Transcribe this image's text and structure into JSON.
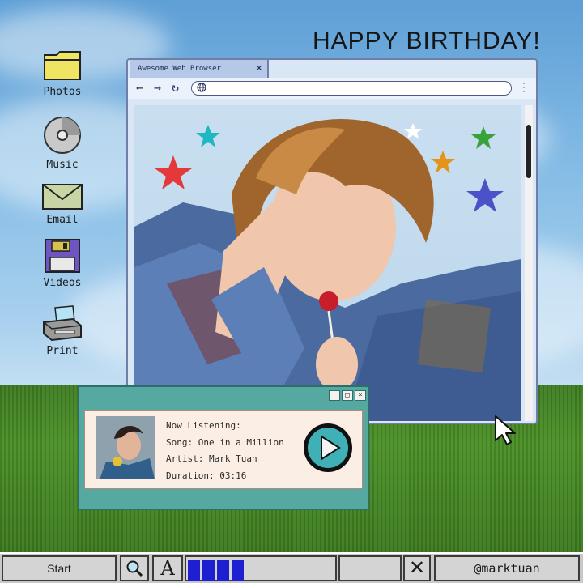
{
  "heading": "HAPPY BIRTHDAY!",
  "desktop_icons": [
    {
      "label": "Photos",
      "icon": "folder-icon"
    },
    {
      "label": "Music",
      "icon": "cd-icon"
    },
    {
      "label": "Email",
      "icon": "envelope-icon"
    },
    {
      "label": "Videos",
      "icon": "floppy-disk-icon"
    },
    {
      "label": "Print",
      "icon": "printer-icon"
    }
  ],
  "browser": {
    "tab_title": "Awesome Web Browser",
    "tab_close": "×",
    "nav": {
      "back": "←",
      "forward": "→",
      "reload": "↻",
      "menu": "⋮"
    },
    "url_value": "",
    "stars": [
      {
        "color": "#e53939"
      },
      {
        "color": "#1fb8c2"
      },
      {
        "color": "#ffffff"
      },
      {
        "color": "#3aa23a"
      },
      {
        "color": "#e4941a"
      },
      {
        "color": "#4a52c8"
      }
    ]
  },
  "player": {
    "window_controls": [
      "_",
      "□",
      "×"
    ],
    "now_listening": "Now Listening:",
    "song": "Song: One in a Million",
    "artist": "Artist: Mark Tuan",
    "duration": "Duration: 03:16",
    "play_icon": "play-icon"
  },
  "taskbar": {
    "start_label": "Start",
    "search_icon": "magnifier-icon",
    "font_icon": "font-a-icon",
    "progress_blocks_filled": 4,
    "close_label": "✕",
    "handle": "@marktuan"
  },
  "colors": {
    "browser_frame": "#6f7fa8",
    "player_teal": "#56a9a1",
    "taskbar_gray": "#c8c8c8",
    "progress_blue": "#1f1fd2"
  }
}
